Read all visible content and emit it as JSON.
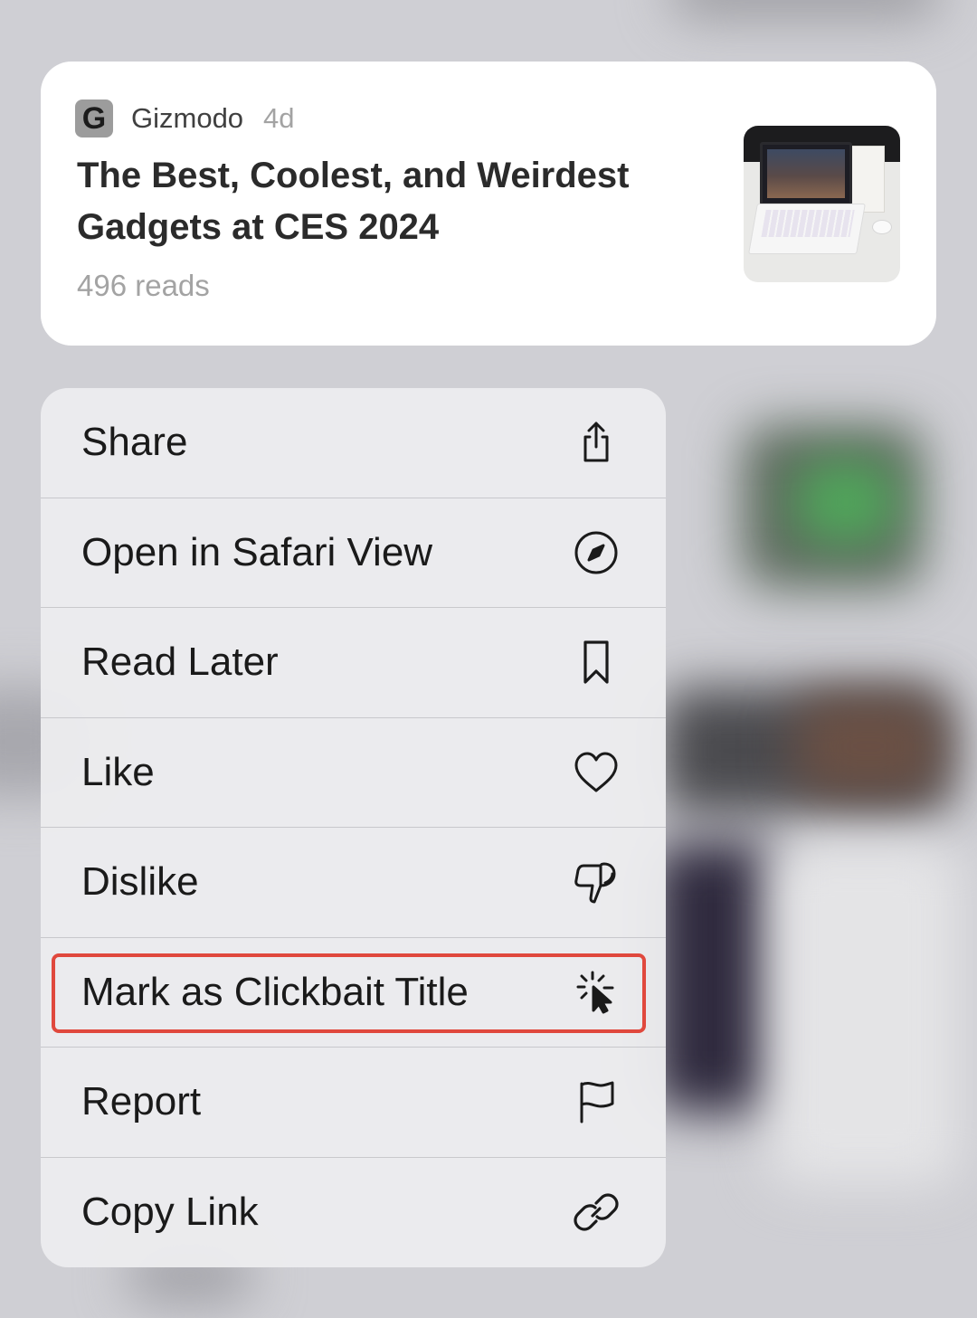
{
  "article": {
    "source_logo_letter": "G",
    "source_name": "Gizmodo",
    "age": "4d",
    "title": "The Best, Coolest, and Weirdest Gadgets at CES 2024",
    "reads": "496 reads"
  },
  "menu": {
    "items": [
      {
        "label": "Share",
        "icon": "share-icon"
      },
      {
        "label": "Open in Safari View",
        "icon": "compass-icon"
      },
      {
        "label": "Read Later",
        "icon": "bookmark-icon"
      },
      {
        "label": "Like",
        "icon": "heart-icon"
      },
      {
        "label": "Dislike",
        "icon": "thumbs-down-icon"
      },
      {
        "label": "Mark as Clickbait Title",
        "icon": "cursor-click-icon"
      },
      {
        "label": "Report",
        "icon": "flag-icon"
      },
      {
        "label": "Copy Link",
        "icon": "link-icon"
      }
    ],
    "highlighted_item": "Mark as Clickbait Title"
  },
  "colors": {
    "highlight_border": "#e0483d",
    "card_background": "#ffffff",
    "menu_background": "#ececee"
  }
}
